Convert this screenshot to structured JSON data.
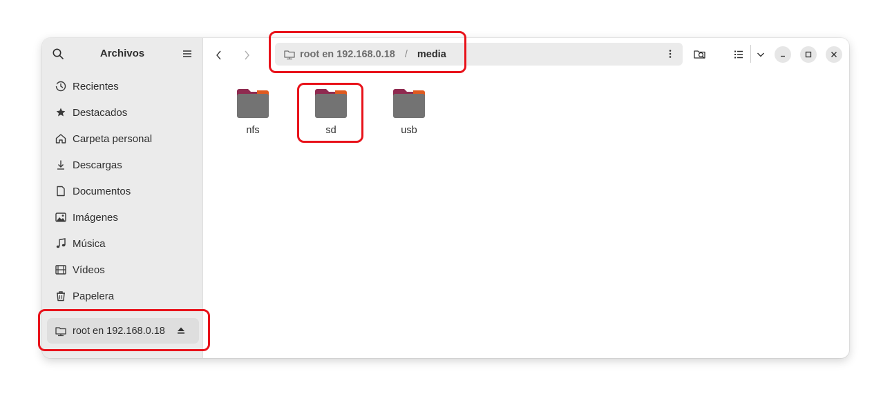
{
  "sidebar": {
    "title": "Archivos",
    "items": [
      {
        "label": "Recientes",
        "icon": "clock-icon"
      },
      {
        "label": "Destacados",
        "icon": "star-icon"
      },
      {
        "label": "Carpeta personal",
        "icon": "home-icon"
      },
      {
        "label": "Descargas",
        "icon": "download-icon"
      },
      {
        "label": "Documentos",
        "icon": "document-icon"
      },
      {
        "label": "Imágenes",
        "icon": "image-icon"
      },
      {
        "label": "Música",
        "icon": "music-icon"
      },
      {
        "label": "Vídeos",
        "icon": "video-icon"
      },
      {
        "label": "Papelera",
        "icon": "trash-icon"
      }
    ],
    "mount": {
      "label": "root en 192.168.0.18",
      "icon": "network-folder-icon"
    }
  },
  "pathbar": {
    "root": "root en 192.168.0.18",
    "separator": "/",
    "current": "media"
  },
  "files": [
    {
      "name": "nfs"
    },
    {
      "name": "sd"
    },
    {
      "name": "usb"
    }
  ],
  "colors": {
    "highlight": "#e8121a",
    "folder_body": "#737373",
    "folder_tab": "#8f2a50",
    "folder_accent": "#e05a1f"
  }
}
